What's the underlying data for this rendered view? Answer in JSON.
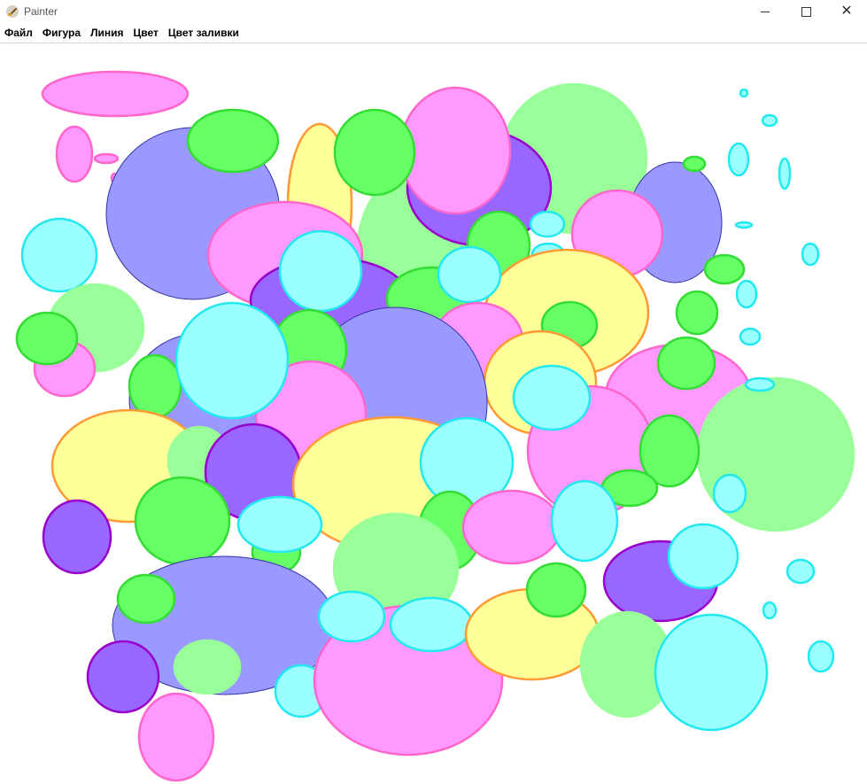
{
  "window": {
    "title": "Painter"
  },
  "menu": {
    "items": [
      {
        "label": "Файл"
      },
      {
        "label": "Фигура"
      },
      {
        "label": "Линия"
      },
      {
        "label": "Цвет"
      },
      {
        "label": "Цвет заливки"
      }
    ]
  },
  "palette": {
    "pink": {
      "fill": "#ff99ff",
      "stroke": "#ff66cc"
    },
    "green": {
      "fill": "#66ff66",
      "stroke": "#33dd33"
    },
    "lgreen": {
      "fill": "#99ff99",
      "stroke": "#99ff99"
    },
    "cyan": {
      "fill": "#99ffff",
      "stroke": "#22e8f0"
    },
    "purple": {
      "fill": "#9966ff",
      "stroke": "#9900cc"
    },
    "blue": {
      "fill": "#9999ff",
      "stroke": "#3333aa"
    },
    "yellow": {
      "fill": "#ffff99",
      "stroke": "#ff9933"
    }
  }
}
